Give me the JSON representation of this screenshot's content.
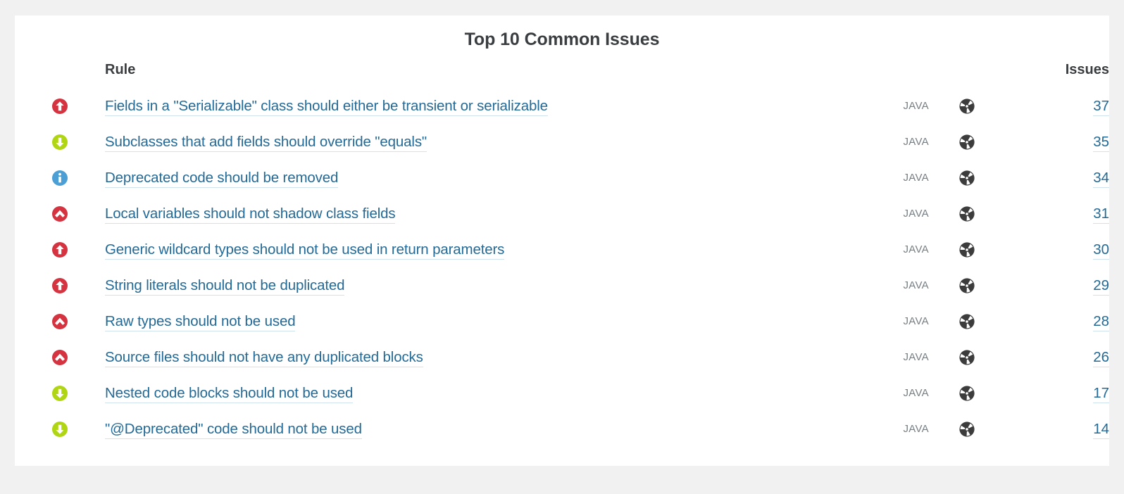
{
  "card": {
    "title": "Top 10 Common Issues"
  },
  "table": {
    "headers": {
      "severity": "",
      "rule": "Rule",
      "language": "",
      "type": "",
      "issues": "Issues"
    },
    "rows": [
      {
        "severity_icon": "severity-major-icon",
        "severity_label": "Major",
        "rule": "Fields in a \"Serializable\" class should either be transient or serializable",
        "language": "JAVA",
        "type_icon": "code-smell-icon",
        "type_label": "Code Smell",
        "issues": "37"
      },
      {
        "severity_icon": "severity-minor-icon",
        "severity_label": "Minor",
        "rule": "Subclasses that add fields should override \"equals\"",
        "language": "JAVA",
        "type_icon": "code-smell-icon",
        "type_label": "Code Smell",
        "issues": "35"
      },
      {
        "severity_icon": "severity-info-icon",
        "severity_label": "Info",
        "rule": "Deprecated code should be removed",
        "language": "JAVA",
        "type_icon": "code-smell-icon",
        "type_label": "Code Smell",
        "issues": "34"
      },
      {
        "severity_icon": "severity-critical-icon",
        "severity_label": "Critical",
        "rule": "Local variables should not shadow class fields",
        "language": "JAVA",
        "type_icon": "code-smell-icon",
        "type_label": "Code Smell",
        "issues": "31"
      },
      {
        "severity_icon": "severity-major-icon",
        "severity_label": "Major",
        "rule": "Generic wildcard types should not be used in return parameters",
        "language": "JAVA",
        "type_icon": "code-smell-icon",
        "type_label": "Code Smell",
        "issues": "30"
      },
      {
        "severity_icon": "severity-major-icon",
        "severity_label": "Major",
        "rule": "String literals should not be duplicated",
        "language": "JAVA",
        "type_icon": "code-smell-icon",
        "type_label": "Code Smell",
        "issues": "29"
      },
      {
        "severity_icon": "severity-critical-icon",
        "severity_label": "Critical",
        "rule": "Raw types should not be used",
        "language": "JAVA",
        "type_icon": "code-smell-icon",
        "type_label": "Code Smell",
        "issues": "28"
      },
      {
        "severity_icon": "severity-critical-icon",
        "severity_label": "Critical",
        "rule": "Source files should not have any duplicated blocks",
        "language": "JAVA",
        "type_icon": "code-smell-icon",
        "type_label": "Code Smell",
        "issues": "26"
      },
      {
        "severity_icon": "severity-minor-icon",
        "severity_label": "Minor",
        "rule": "Nested code blocks should not be used",
        "language": "JAVA",
        "type_icon": "code-smell-icon",
        "type_label": "Code Smell",
        "issues": "17"
      },
      {
        "severity_icon": "severity-minor-icon",
        "severity_label": "Minor",
        "rule": "\"@Deprecated\" code should not be used",
        "language": "JAVA",
        "type_icon": "code-smell-icon",
        "type_label": "Code Smell",
        "issues": "14"
      }
    ]
  },
  "colors": {
    "page_background": "#f1f1f1",
    "card_background": "#ffffff",
    "heading_text": "#3a3e41",
    "link_blue": "#236a97",
    "link_underline": "#cfe3ef",
    "language_text": "#777f84",
    "severity_major": "#d4333f",
    "severity_critical": "#d4333f",
    "severity_minor": "#b0d513",
    "severity_info": "#4b9fd5",
    "type_code_smell": "#3c3c3c"
  }
}
